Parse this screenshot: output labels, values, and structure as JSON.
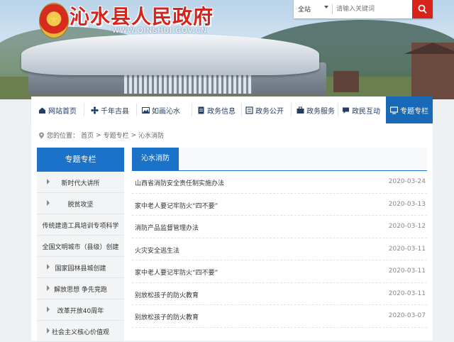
{
  "header": {
    "site_name": "沁水县人民政府",
    "domain": "WWW.QINSHUI.GOV.CN",
    "emblem": "national-emblem"
  },
  "search": {
    "scope": "全站",
    "placeholder": "请输入关键词",
    "icon": "search-icon"
  },
  "nav": {
    "items": [
      {
        "label": "网站首页",
        "icon": "home-icon"
      },
      {
        "label": "千年古县",
        "icon": "flower-icon"
      },
      {
        "label": "如画沁水",
        "icon": "picture-icon"
      },
      {
        "label": "政务信息",
        "icon": "document-icon"
      },
      {
        "label": "政务公开",
        "icon": "open-file-icon"
      },
      {
        "label": "政务服务",
        "icon": "service-icon"
      },
      {
        "label": "政民互动",
        "icon": "chat-icon"
      },
      {
        "label": "专题专栏",
        "icon": "monitor-icon"
      }
    ],
    "active_color": "#1869b7"
  },
  "breadcrumb": {
    "prefix": "您的位置：",
    "items": [
      "首页",
      "专题专栏",
      "沁水消防"
    ],
    "separator": ">"
  },
  "sidebar": {
    "title": "专题专栏",
    "items": [
      {
        "label": "新时代大讲所"
      },
      {
        "label": "脱贫攻坚"
      },
      {
        "label": "传统建造工具培训专项科学"
      },
      {
        "label": "全国文明城市（县级）创建"
      },
      {
        "label": "国家园林县城创建"
      },
      {
        "label": "解放思想 争先竞跑"
      },
      {
        "label": "改革开放40周年"
      },
      {
        "label": "社会主义核心价值观"
      }
    ]
  },
  "main": {
    "tab_label": "沁水消防",
    "articles": [
      {
        "title": "山西省消防安全责任制实施办法",
        "date": "2020-03-24"
      },
      {
        "title": "家中老人要记牢防火“四不要”",
        "date": "2020-03-13"
      },
      {
        "title": "消防产品监督管理办法",
        "date": "2020-03-12"
      },
      {
        "title": "火灾安全逃生法",
        "date": "2020-03-11"
      },
      {
        "title": "家中老人要记牢防火“四不要”",
        "date": "2020-03-11"
      },
      {
        "title": "别放松孩子的防火教育",
        "date": "2020-03-11"
      },
      {
        "title": "别放松孩子的防火教育",
        "date": "2020-03-07"
      }
    ]
  },
  "colors": {
    "brand_red": "#d6231b",
    "accent_blue": "#1a73c8"
  }
}
